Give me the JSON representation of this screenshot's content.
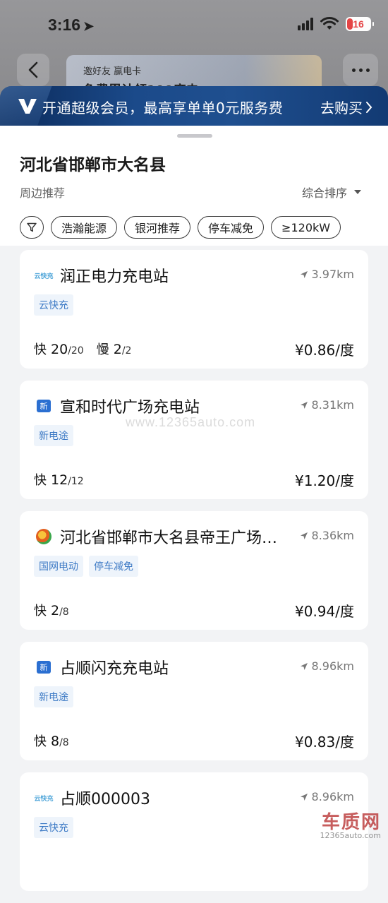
{
  "status_bar": {
    "time": "3:16",
    "battery": "16"
  },
  "header": {
    "promo_line1": "邀好友 赢电卡",
    "promo_line2": "免费累计领100度电"
  },
  "vip_banner": {
    "text": "开通超级会员，最高享单单0元服务费",
    "buy_label": "去购买"
  },
  "sheet": {
    "region": "河北省邯郸市大名县",
    "nearby_label": "周边推荐",
    "sort_label": "综合排序",
    "filters": [
      "浩瀚能源",
      "银河推荐",
      "停车减免",
      "≥120kW"
    ]
  },
  "stations": [
    {
      "logo": "云快充",
      "name": "润正电力充电站",
      "distance": "3.97km",
      "tags": [
        "云快充"
      ],
      "fast_label": "快",
      "fast_avail": "20",
      "fast_total": "/20",
      "slow_label": "慢",
      "slow_avail": "2",
      "slow_total": "/2",
      "price": "¥0.86/度"
    },
    {
      "logo": "新",
      "name": "宣和时代广场充电站",
      "distance": "8.31km",
      "tags": [
        "新电途"
      ],
      "fast_label": "快",
      "fast_avail": "12",
      "fast_total": "/12",
      "price": "¥1.20/度"
    },
    {
      "logo": "",
      "name": "河北省邯郸市大名县帝王广场…",
      "distance": "8.36km",
      "tags": [
        "国网电动",
        "停车减免"
      ],
      "fast_label": "快",
      "fast_avail": "2",
      "fast_total": "/8",
      "price": "¥0.94/度"
    },
    {
      "logo": "新",
      "name": "占顺闪充充电站",
      "distance": "8.96km",
      "tags": [
        "新电途"
      ],
      "fast_label": "快",
      "fast_avail": "8",
      "fast_total": "/8",
      "price": "¥0.83/度"
    },
    {
      "logo": "云快充",
      "name": "占顺000003",
      "distance": "8.96km",
      "tags": [
        "云快充"
      ]
    }
  ],
  "watermark": {
    "text": "www.12365auto.com",
    "logo_big": "车质网",
    "logo_small": "12365auto.com"
  },
  "colors": {
    "tag_bg": "#eef4fb",
    "tag_text": "#3d7ac5",
    "banner_bg": "#1b4a8a"
  }
}
